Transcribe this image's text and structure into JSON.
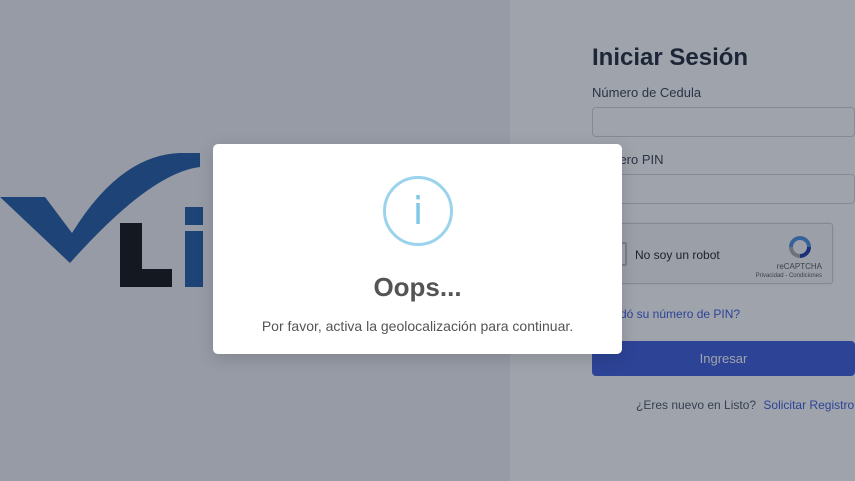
{
  "login": {
    "title": "Iniciar Sesión",
    "cedula_label": "Número de Cedula",
    "cedula_value": "",
    "pin_label": "Número PIN",
    "pin_value": "",
    "recaptcha_label": "No soy un robot",
    "recaptcha_brand": "reCAPTCHA",
    "recaptcha_links": "Privacidad - Condiciones",
    "forgot_pin": "¿Olvidó su número de PIN?",
    "submit_label": "Ingresar",
    "register_question": "¿Eres nuevo en Listo?",
    "register_link": "Solicitar Registro"
  },
  "logo": {
    "text": "Li"
  },
  "modal": {
    "icon": "info-icon",
    "icon_glyph": "i",
    "title": "Oops...",
    "message": "Por favor, activa la geolocalización para continuar."
  },
  "colors": {
    "brand_blue": "#1f5aa6",
    "accent": "#3b5bdb",
    "info": "#9bd3ec",
    "overlay": "#1a2337"
  }
}
